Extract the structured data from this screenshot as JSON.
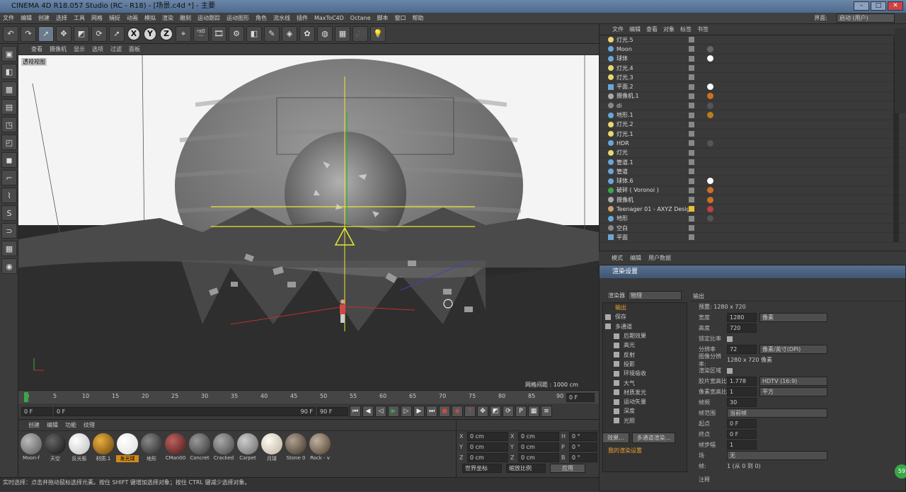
{
  "window": {
    "title": "CINEMA 4D R18.057 Studio (RC - R18) - [场景.c4d *] - 主要"
  },
  "menu": [
    "文件",
    "编辑",
    "创建",
    "选择",
    "工具",
    "网格",
    "捕捉",
    "动画",
    "模拟",
    "渲染",
    "雕刻",
    "运动跟踪",
    "运动图形",
    "角色",
    "流水线",
    "插件",
    "MaxToC4D",
    "Octane",
    "脚本",
    "窗口",
    "帮助"
  ],
  "interface": {
    "label": "界面:",
    "value": "启动 (用户)"
  },
  "viewport": {
    "menu": [
      "查看",
      "摄像机",
      "显示",
      "选项",
      "过滤",
      "面板"
    ],
    "label": "透视视图",
    "grid_spacing": "网格间距 : 1000 cm"
  },
  "timeline": {
    "ticks": [
      "0",
      "5",
      "10",
      "15",
      "20",
      "25",
      "30",
      "35",
      "40",
      "45",
      "50",
      "55",
      "60",
      "65",
      "70",
      "75",
      "80",
      "85",
      "90"
    ],
    "current": "0 F",
    "start": "0 F",
    "range_start": "0 F",
    "range_end": "90 F",
    "end": "90 F"
  },
  "materials": {
    "tabs": [
      "创建",
      "编辑",
      "功能",
      "纹理"
    ],
    "items": [
      {
        "name": "Moon-f",
        "color": "#8a8a80"
      },
      {
        "name": "天空",
        "color": "#303030"
      },
      {
        "name": "反光板",
        "color": "#f2f2f2"
      },
      {
        "name": "材质.1",
        "color": "#b87d18"
      },
      {
        "name": "发光球",
        "color": "#ffffff"
      },
      {
        "name": "地形",
        "color": "#5a5a5a"
      },
      {
        "name": "CMan00",
        "color": "#8a4040"
      },
      {
        "name": "Concret",
        "color": "#6a6a6a"
      },
      {
        "name": "Cracked",
        "color": "#7a7a7a"
      },
      {
        "name": "Carpet",
        "color": "#9a9a9a"
      },
      {
        "name": "月球",
        "color": "#eeeae0"
      },
      {
        "name": "Stone 0",
        "color": "#7a6a5a"
      },
      {
        "name": "Rock - v",
        "color": "#8a7a6a"
      }
    ]
  },
  "coords": {
    "rows": [
      {
        "a": "X",
        "av": "0 cm",
        "b": "X",
        "bv": "0 cm",
        "c": "H",
        "cv": "0 °"
      },
      {
        "a": "Y",
        "av": "0 cm",
        "b": "Y",
        "bv": "0 cm",
        "c": "P",
        "cv": "0 °"
      },
      {
        "a": "Z",
        "av": "0 cm",
        "b": "Z",
        "bv": "0 cm",
        "c": "B",
        "cv": "0 °"
      }
    ],
    "world": "世界坐标",
    "scale": "缩放比例",
    "apply": "应用"
  },
  "status": "实时选择：点击并拖动鼠标选择元素。按住 SHIFT 键增加选择对象；按住 CTRL 键减少选择对象。",
  "objects": {
    "menu": [
      "文件",
      "编辑",
      "查看",
      "对象",
      "标签",
      "书签"
    ],
    "items": [
      "灯光.5",
      "Moon",
      "球体",
      "灯光.4",
      "灯光.3",
      "平面.2",
      "摄像机.1",
      "di",
      "地形.1",
      "灯光.2",
      "灯光.1",
      "HDR",
      "灯光",
      "管道.1",
      "管道",
      "球体.6",
      "破碎 ( Voronoi )",
      "摄像机",
      "Teenager 01 - AXYZ Design",
      "地形",
      "空白",
      "平面"
    ]
  },
  "attributes": {
    "tabs": [
      "模式",
      "编辑",
      "用户数据"
    ]
  },
  "render": {
    "title": "渲染设置",
    "renderer_label": "渲染器",
    "renderer": "物理",
    "sections": [
      "输出",
      "保存",
      "多通道",
      "后期效果",
      "高光",
      "反射",
      "投影",
      "环境吸收",
      "大气",
      "材质发光",
      "运动矢量",
      "深度",
      "光照"
    ],
    "effects_btn": "效果...",
    "multipass_btn": "多通道渲染...",
    "my_settings": "我的渲染设置",
    "output_header": "输出",
    "preset": "预置: 1280 x 720",
    "props": [
      {
        "label": "宽度",
        "value": "1280",
        "unit": "像素"
      },
      {
        "label": "高度",
        "value": "720",
        "unit": ""
      },
      {
        "label": "锁定比率",
        "value": "",
        "unit": ""
      },
      {
        "label": "分辨率",
        "value": "72",
        "unit": "像素/英寸(DPI)"
      },
      {
        "label": "图像分辨率:",
        "value": "1280 x 720 像素",
        "unit": ""
      },
      {
        "label": "渲染区域",
        "value": "",
        "unit": ""
      },
      {
        "label": "胶片宽高比",
        "value": "1.778",
        "unit": "HDTV (16:9)"
      },
      {
        "label": "像素宽高比",
        "value": "1",
        "unit": "平方"
      },
      {
        "label": "帧频",
        "value": "30",
        "unit": ""
      },
      {
        "label": "帧范围",
        "value": "",
        "unit": "当前帧"
      },
      {
        "label": "起点",
        "value": "0 F",
        "unit": ""
      },
      {
        "label": "终点",
        "value": "0 F",
        "unit": ""
      },
      {
        "label": "帧步幅",
        "value": "1",
        "unit": ""
      },
      {
        "label": "场",
        "value": "",
        "unit": "无"
      },
      {
        "label": "帧:",
        "value": "1 (从 0 到 0)",
        "unit": ""
      },
      {
        "label": "注释",
        "value": "",
        "unit": ""
      }
    ]
  },
  "badge": "59"
}
